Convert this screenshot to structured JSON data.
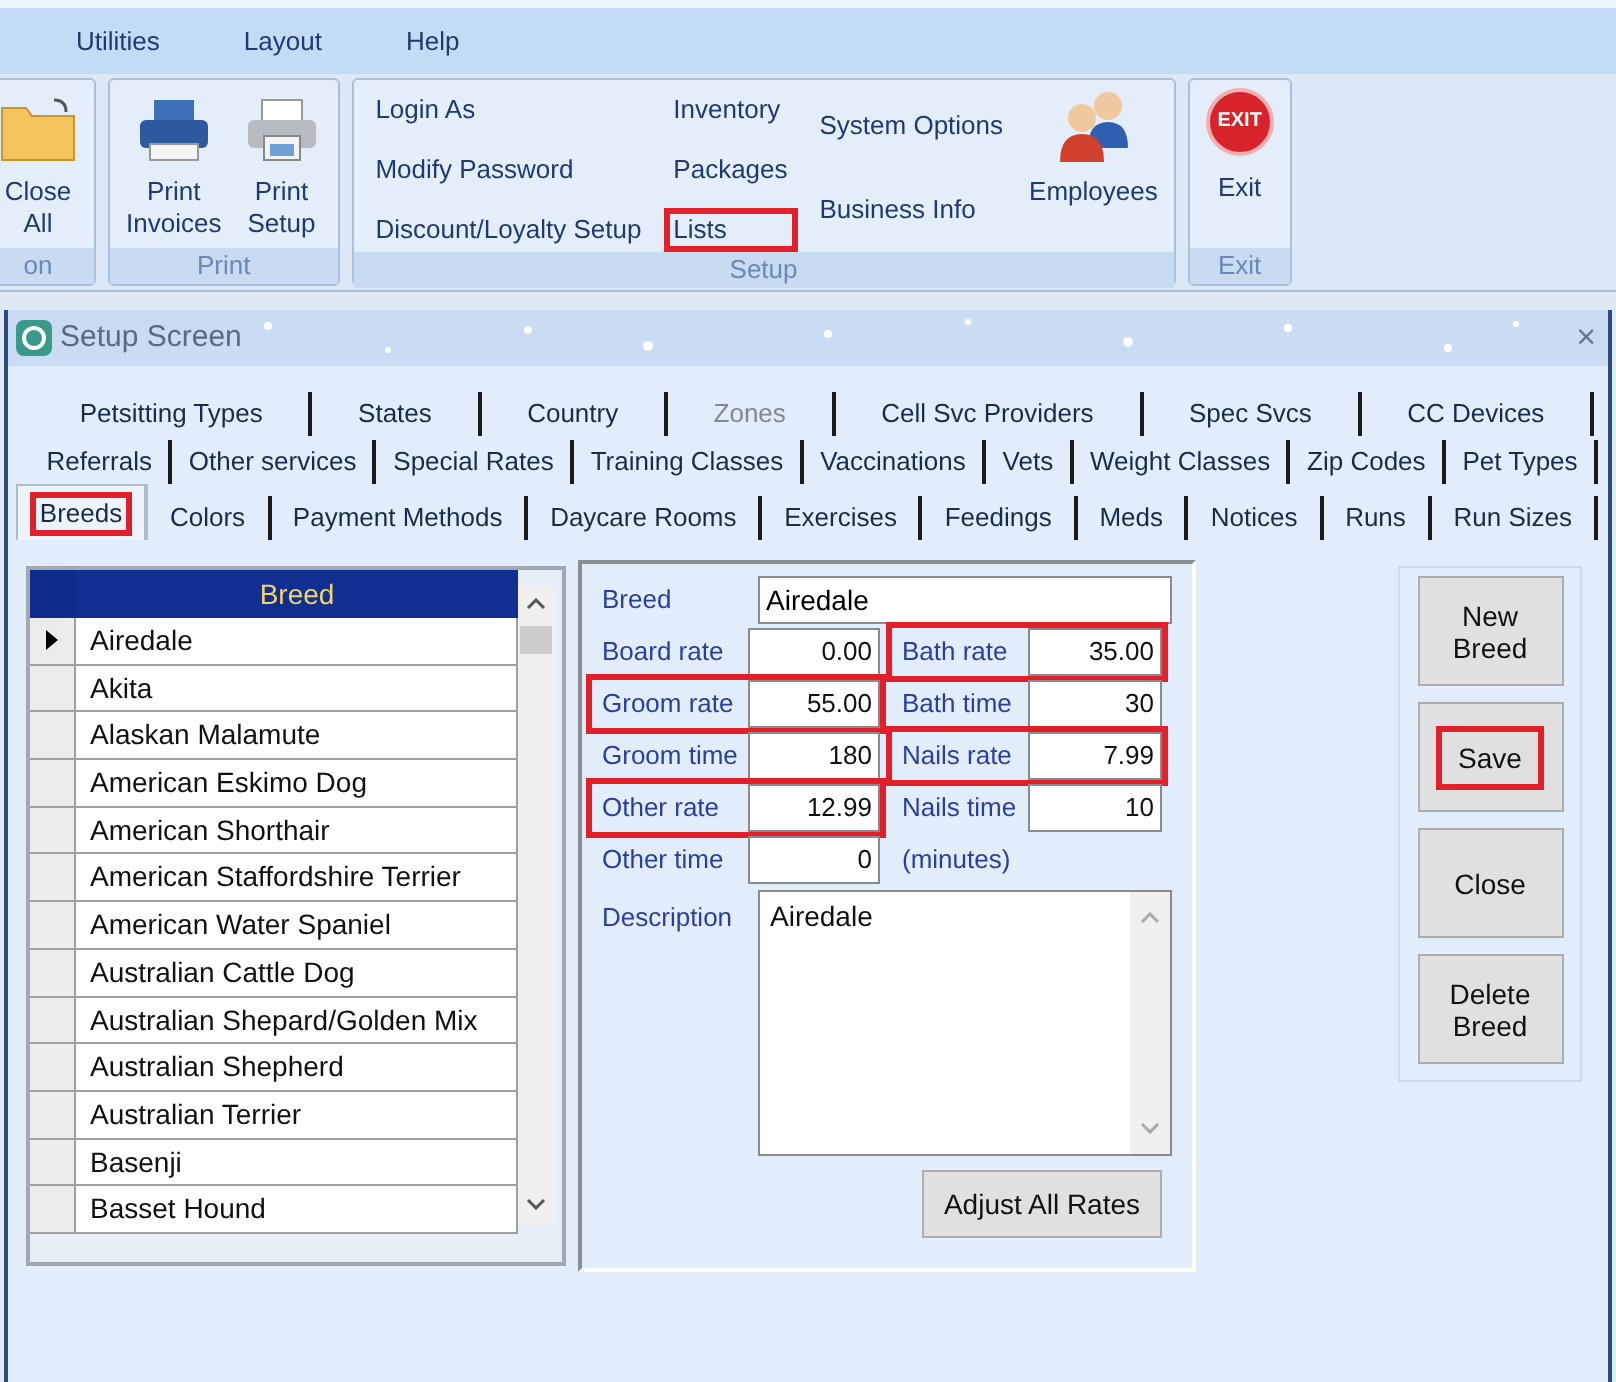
{
  "menu": [
    "Utilities",
    "Layout",
    "Help"
  ],
  "ribbon": [
    {
      "label": "on",
      "items": [
        {
          "kind": "large",
          "label": "Close All"
        }
      ]
    },
    {
      "label": "Print",
      "items": [
        {
          "kind": "large",
          "label": "Print Invoices"
        },
        {
          "kind": "large",
          "label": "Print Setup"
        }
      ]
    },
    {
      "label": "Setup",
      "items": [
        {
          "kind": "column",
          "items": [
            {
              "label": "Login As",
              "highlighted": false
            },
            {
              "label": "Modify Password",
              "highlighted": false
            },
            {
              "label": "Discount/Loyalty Setup",
              "highlighted": false
            }
          ]
        },
        {
          "kind": "column",
          "items": [
            {
              "label": "Inventory",
              "highlighted": false
            },
            {
              "label": "Packages",
              "highlighted": false
            },
            {
              "label": "Lists",
              "highlighted": true
            }
          ]
        },
        {
          "kind": "column2",
          "items": [
            {
              "label": "System Options",
              "highlighted": false
            },
            {
              "label": "Business Info",
              "highlighted": false
            }
          ]
        },
        {
          "kind": "large",
          "label": "Employees"
        }
      ]
    },
    {
      "label": "Exit",
      "items": [
        {
          "kind": "large",
          "label": "Exit",
          "badge": "EXIT"
        }
      ]
    }
  ],
  "window": {
    "title": "Setup Screen",
    "close": "×"
  },
  "tab_rows": [
    [
      {
        "label": "Petsitting Types",
        "selected": false,
        "disabled": false
      },
      {
        "label": "States",
        "selected": false,
        "disabled": false
      },
      {
        "label": "Country",
        "selected": false,
        "disabled": false
      },
      {
        "label": "Zones",
        "selected": false,
        "disabled": true
      },
      {
        "label": "Cell Svc Providers",
        "selected": false,
        "disabled": false
      },
      {
        "label": "Spec Svcs",
        "selected": false,
        "disabled": false
      },
      {
        "label": "CC Devices",
        "selected": false,
        "disabled": false
      }
    ],
    [
      {
        "label": "Referrals",
        "selected": false,
        "disabled": false
      },
      {
        "label": "Other services",
        "selected": false,
        "disabled": false
      },
      {
        "label": "Special Rates",
        "selected": false,
        "disabled": false
      },
      {
        "label": "Training Classes",
        "selected": false,
        "disabled": false
      },
      {
        "label": "Vaccinations",
        "selected": false,
        "disabled": false
      },
      {
        "label": "Vets",
        "selected": false,
        "disabled": false
      },
      {
        "label": "Weight Classes",
        "selected": false,
        "disabled": false
      },
      {
        "label": "Zip Codes",
        "selected": false,
        "disabled": false
      },
      {
        "label": "Pet Types",
        "selected": false,
        "disabled": false
      }
    ],
    [
      {
        "label": "Breeds",
        "selected": true,
        "disabled": false,
        "highlighted": true
      },
      {
        "label": "Colors",
        "selected": false,
        "disabled": false
      },
      {
        "label": "Payment Methods",
        "selected": false,
        "disabled": false
      },
      {
        "label": "Daycare Rooms",
        "selected": false,
        "disabled": false
      },
      {
        "label": "Exercises",
        "selected": false,
        "disabled": false
      },
      {
        "label": "Feedings",
        "selected": false,
        "disabled": false
      },
      {
        "label": "Meds",
        "selected": false,
        "disabled": false
      },
      {
        "label": "Notices",
        "selected": false,
        "disabled": false
      },
      {
        "label": "Runs",
        "selected": false,
        "disabled": false
      },
      {
        "label": "Run Sizes",
        "selected": false,
        "disabled": false
      }
    ]
  ],
  "grid": {
    "header": "Breed",
    "rows": [
      {
        "name": "Airedale",
        "current": true
      },
      {
        "name": "Akita",
        "current": false
      },
      {
        "name": "Alaskan Malamute",
        "current": false
      },
      {
        "name": "American Eskimo Dog",
        "current": false
      },
      {
        "name": "American Shorthair",
        "current": false
      },
      {
        "name": "American Staffordshire Terrier",
        "current": false
      },
      {
        "name": "American Water Spaniel",
        "current": false
      },
      {
        "name": "Australian Cattle Dog",
        "current": false
      },
      {
        "name": "Australian Shepard/Golden Mix",
        "current": false
      },
      {
        "name": "Australian Shepherd",
        "current": false
      },
      {
        "name": "Australian Terrier",
        "current": false
      },
      {
        "name": "Basenji",
        "current": false
      },
      {
        "name": "Basset Hound",
        "current": false
      }
    ]
  },
  "form": {
    "breed": {
      "label": "Breed",
      "value": "Airedale"
    },
    "rows": [
      {
        "left": {
          "label": "Board rate",
          "value": "0.00",
          "highlighted": false
        },
        "right": {
          "kind": "field",
          "label": "Bath rate",
          "value": "35.00",
          "highlighted": true
        }
      },
      {
        "left": {
          "label": "Groom rate",
          "value": "55.00",
          "highlighted": true
        },
        "right": {
          "kind": "field",
          "label": "Bath time",
          "value": "30",
          "highlighted": false
        }
      },
      {
        "left": {
          "label": "Groom time",
          "value": "180",
          "highlighted": false
        },
        "right": {
          "kind": "field",
          "label": "Nails rate",
          "value": "7.99",
          "highlighted": true
        }
      },
      {
        "left": {
          "label": "Other rate",
          "value": "12.99",
          "highlighted": true
        },
        "right": {
          "kind": "field",
          "label": "Nails time",
          "value": "10",
          "highlighted": false
        }
      },
      {
        "left": {
          "label": "Other time",
          "value": "0",
          "highlighted": false
        },
        "right": {
          "kind": "note",
          "label": "(minutes)"
        }
      }
    ],
    "description": {
      "label": "Description",
      "value": "Airedale"
    },
    "adjust_button": "Adjust All Rates"
  },
  "buttons": [
    {
      "label": "New Breed",
      "highlighted": false
    },
    {
      "label": "Save",
      "highlighted": true
    },
    {
      "label": "Close",
      "highlighted": false
    },
    {
      "label": "Delete Breed",
      "highlighted": false
    }
  ]
}
